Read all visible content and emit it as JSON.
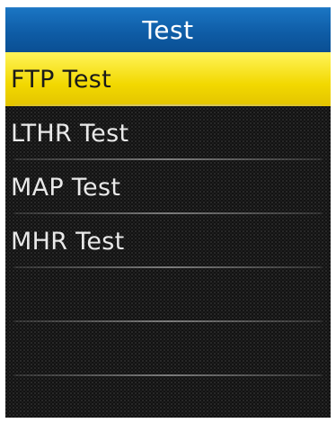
{
  "header": {
    "title": "Test"
  },
  "menu": {
    "items": [
      {
        "label": "FTP Test",
        "selected": true
      },
      {
        "label": "LTHR Test",
        "selected": false
      },
      {
        "label": "MAP Test",
        "selected": false
      },
      {
        "label": "MHR Test",
        "selected": false
      },
      {
        "label": "",
        "selected": false
      },
      {
        "label": "",
        "selected": false
      },
      {
        "label": "",
        "selected": false
      }
    ]
  },
  "colors": {
    "header_blue": "#0f5da7",
    "selection_yellow": "#f2d800",
    "background_dark": "#121212"
  }
}
